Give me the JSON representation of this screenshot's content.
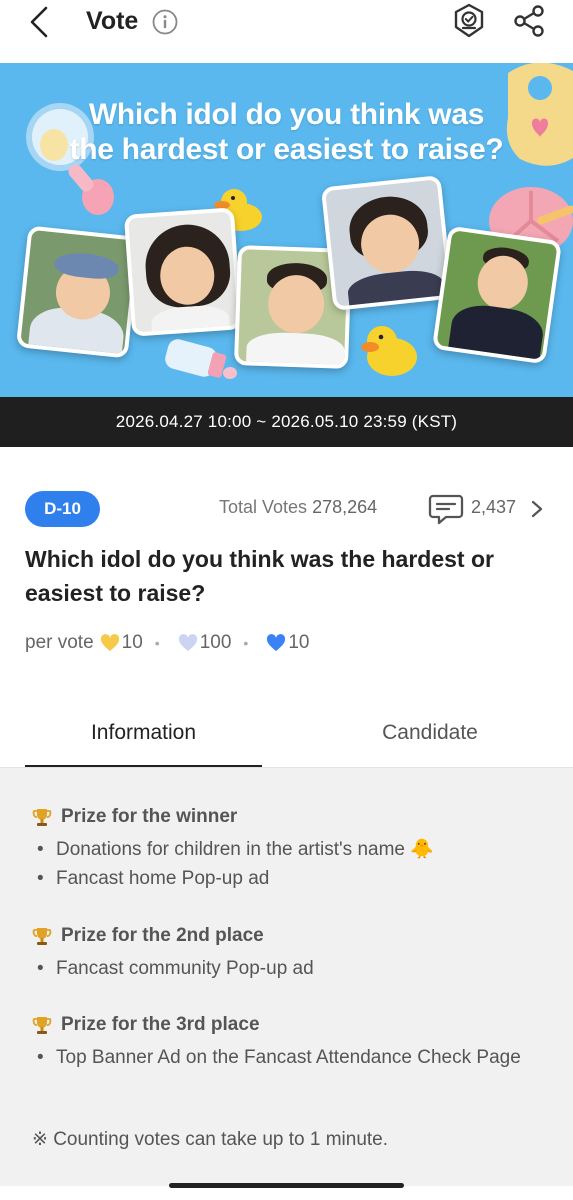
{
  "header": {
    "title": "Vote",
    "icons": [
      "back-icon",
      "info-icon",
      "badge-icon",
      "share-icon"
    ]
  },
  "banner": {
    "title_line1": "Which idol do you think was",
    "title_line2": "the hardest or easiest to raise?",
    "date_range": "2026.04.27 10:00 ~ 2026.05.10 23:59 (KST)"
  },
  "meta": {
    "dday": "D-10",
    "total_label": "Total Votes",
    "total_value": "278,264",
    "comment_count": "2,437"
  },
  "question": "Which idol do you think was the hardest or easiest to raise?",
  "per_vote": {
    "label": "per vote",
    "items": [
      {
        "value": "10",
        "color": "#f6c94a"
      },
      {
        "value": "100",
        "color": "#cdd3f3"
      },
      {
        "value": "10",
        "color": "#3b82f6"
      }
    ],
    "separator": "•"
  },
  "tabs": {
    "information": "Information",
    "candidate": "Candidate"
  },
  "prizes": [
    {
      "title": "Prize for the winner",
      "items": [
        "Donations for children in the artist's name 🐥",
        "Fancast home Pop-up ad"
      ]
    },
    {
      "title": "Prize for the 2nd place",
      "items": [
        "Fancast community Pop-up ad"
      ]
    },
    {
      "title": "Prize for the 3rd place",
      "items": [
        "Top Banner Ad on the Fancast Attendance Check Page"
      ]
    }
  ],
  "bullet_char": "•",
  "note": "※ Counting votes can take up to 1 minute.",
  "colors": {
    "accent": "#2f80ed",
    "banner_bg": "#5ab8ee",
    "date_bar_bg": "#1f1f1f",
    "panel_bg": "#f1f1f2"
  }
}
